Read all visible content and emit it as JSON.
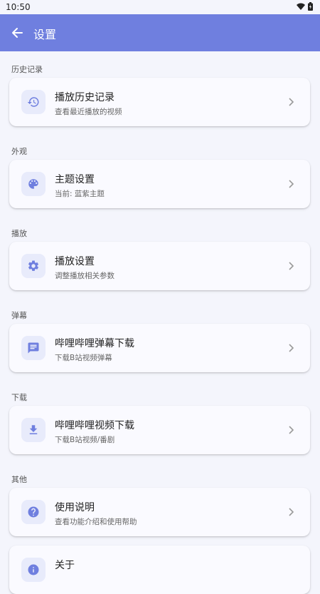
{
  "status": {
    "time": "10:50"
  },
  "header": {
    "title": "设置"
  },
  "sections": [
    {
      "title": "历史记录",
      "item": {
        "title": "播放历史记录",
        "subtitle": "查看最近播放的视频",
        "icon": "history-icon"
      }
    },
    {
      "title": "外观",
      "item": {
        "title": "主题设置",
        "subtitle": "当前: 蓝紫主题",
        "icon": "palette-icon"
      }
    },
    {
      "title": "播放",
      "item": {
        "title": "播放设置",
        "subtitle": "调整播放相关参数",
        "icon": "gear-icon"
      }
    },
    {
      "title": "弹幕",
      "item": {
        "title": "哔哩哔哩弹幕下载",
        "subtitle": "下载B站视频弹幕",
        "icon": "message-icon"
      }
    },
    {
      "title": "下载",
      "item": {
        "title": "哔哩哔哩视频下载",
        "subtitle": "下载B站视频/番剧",
        "icon": "download-icon"
      }
    },
    {
      "title": "其他",
      "item": {
        "title": "使用说明",
        "subtitle": "查看功能介绍和使用帮助",
        "icon": "help-icon"
      }
    },
    {
      "title": "",
      "item": {
        "title": "关于",
        "subtitle": "",
        "icon": "info-icon"
      }
    }
  ],
  "colors": {
    "primary": "#6f7fdf",
    "icon_bg": "#e8ebfb",
    "background": "#f4f5fc"
  }
}
